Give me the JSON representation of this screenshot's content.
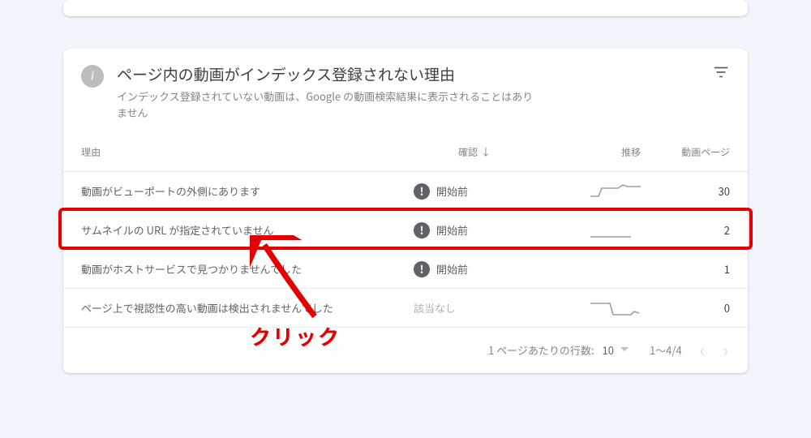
{
  "header": {
    "title": "ページ内の動画がインデックス登録されない理由",
    "subtitle": "インデックス登録されていない動画は、Google の動画検索結果に表示されることはありません"
  },
  "columns": {
    "reason": "理由",
    "confirm": "確認",
    "trend": "推移",
    "count": "動画ページ"
  },
  "rows": [
    {
      "reason": "動画がビューポートの外側にあります",
      "status_icon": true,
      "status": "開始前",
      "count": "30",
      "spark": "step"
    },
    {
      "reason": "サムネイルの URL が指定されていません",
      "status_icon": true,
      "status": "開始前",
      "count": "2",
      "spark": "flat"
    },
    {
      "reason": "動画がホストサービスで見つかりませんでした",
      "status_icon": true,
      "status": "開始前",
      "count": "1",
      "spark": "none"
    },
    {
      "reason": "ページ上で視認性の高い動画は検出されませんでした",
      "status_icon": false,
      "status": "該当なし",
      "count": "0",
      "spark": "drop"
    }
  ],
  "footer": {
    "rows_per_page_label": "1 ページあたりの行数:",
    "rows_per_page_value": "10",
    "range": "1～4/4"
  },
  "annotation": {
    "label": "クリック"
  }
}
